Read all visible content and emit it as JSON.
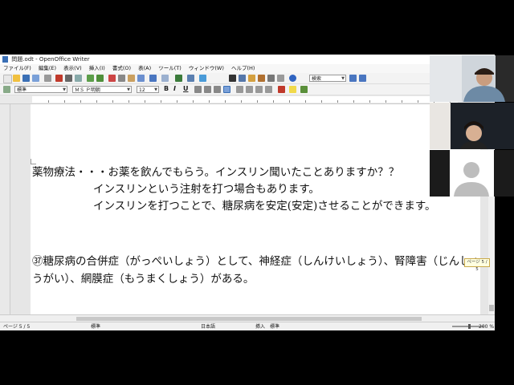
{
  "window": {
    "title": "問題.odt - OpenOffice Writer"
  },
  "menu": [
    "ファイル(F)",
    "編集(E)",
    "表示(V)",
    "挿入(I)",
    "書式(O)",
    "表(A)",
    "ツール(T)",
    "ウィンドウ(W)",
    "ヘルプ(H)"
  ],
  "toolbar": {
    "search_placeholder": "検索"
  },
  "format": {
    "style": "標準",
    "font": "ＭＳ Ｐ明朝",
    "size": "12",
    "bold": "B",
    "italic": "I",
    "underline": "U"
  },
  "document": {
    "lines": [
      "薬物療法・・・お薬を飲んでもらう。インスリン聞いたことありますか？？",
      "インスリンという注射を打つ場合もあります。",
      "インスリンを打つことで、糖尿病を安定(安定)させることができます。",
      "㊲糖尿病の合併症（がっぺいしょう）として、神経症（しんけいしょう）、腎障害（じんしょ",
      "うがい）、網膜症（もうまくしょう）がある。"
    ],
    "page_badge": "ページ 5 / 5"
  },
  "status": {
    "page": "ページ 5 / 5",
    "style": "標準",
    "language": "日本語",
    "insert": "挿入",
    "mode": "標準",
    "zoom": "200 %"
  },
  "colors": {
    "accent": "#3a6fb5",
    "highlight": "#ffffe0"
  }
}
